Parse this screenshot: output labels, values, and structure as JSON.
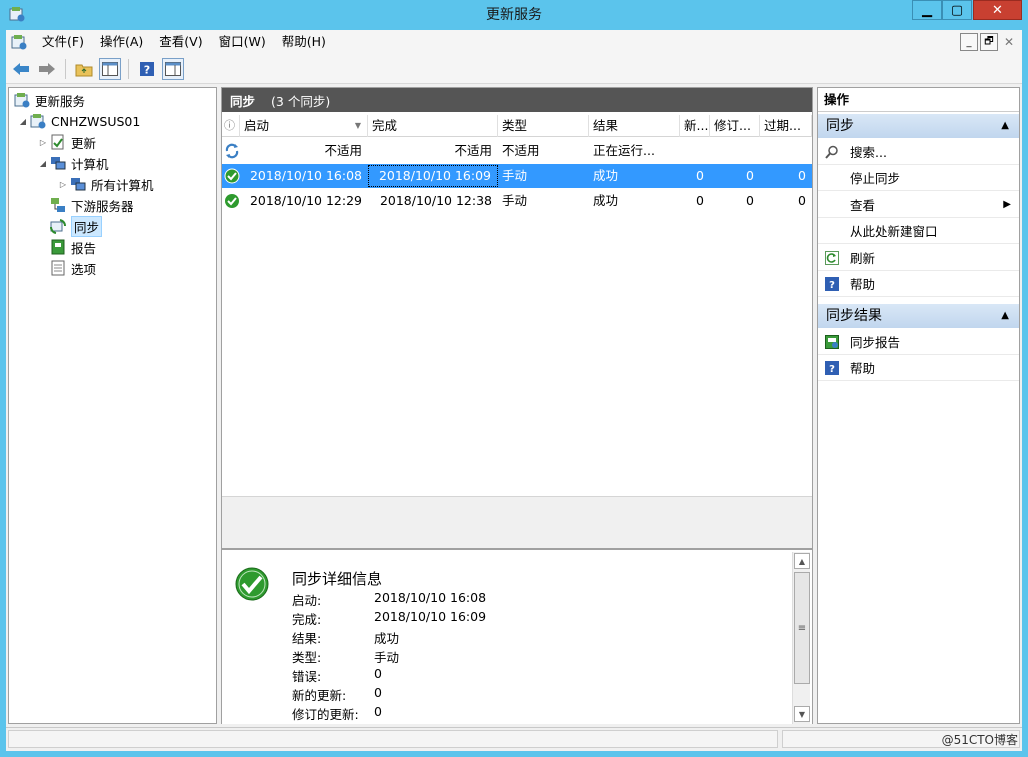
{
  "window": {
    "title": "更新服务",
    "min_glyph": "▁",
    "max_glyph": "▢",
    "close_glyph": "✕"
  },
  "menu": {
    "items": [
      "文件(F)",
      "操作(A)",
      "查看(V)",
      "窗口(W)",
      "帮助(H)"
    ]
  },
  "mdi": {
    "min": "_",
    "restore": "🗗",
    "close": "✕"
  },
  "tree": {
    "root": "更新服务",
    "server": "CNHZWSUS01",
    "updates": "更新",
    "computers": "计算机",
    "all_computers": "所有计算机",
    "downstream": "下游服务器",
    "sync": "同步",
    "reports": "报告",
    "options": "选项"
  },
  "middle": {
    "header_title": "同步",
    "header_sub": "(3 个同步)",
    "columns": [
      "启动",
      "完成",
      "类型",
      "结果",
      "新...",
      "修订...",
      "过期..."
    ],
    "rows": [
      {
        "start": "不适用",
        "finish": "不适用",
        "type": "不适用",
        "result": "正在运行...",
        "new": "",
        "revised": "",
        "expired": ""
      },
      {
        "start": "2018/10/10 16:08",
        "finish": "2018/10/10 16:09",
        "type": "手动",
        "result": "成功",
        "new": "0",
        "revised": "0",
        "expired": "0"
      },
      {
        "start": "2018/10/10 12:29",
        "finish": "2018/10/10 12:38",
        "type": "手动",
        "result": "成功",
        "new": "0",
        "revised": "0",
        "expired": "0"
      }
    ]
  },
  "detail": {
    "title": "同步详细信息",
    "fields": [
      {
        "label": "启动:",
        "value": "2018/10/10 16:08"
      },
      {
        "label": "完成:",
        "value": "2018/10/10 16:09"
      },
      {
        "label": "结果:",
        "value": "成功"
      },
      {
        "label": "类型:",
        "value": "手动"
      },
      {
        "label": "错误:",
        "value": "0"
      },
      {
        "label": "新的更新:",
        "value": "0"
      },
      {
        "label": "修订的更新:",
        "value": "0"
      }
    ]
  },
  "actions": {
    "header": "操作",
    "section1": "同步",
    "search": "搜索...",
    "stop_sync": "停止同步",
    "view": "查看",
    "new_window": "从此处新建窗口",
    "refresh": "刷新",
    "help1": "帮助",
    "section2": "同步结果",
    "sync_report": "同步报告",
    "help2": "帮助"
  },
  "watermark": "@51CTO博客",
  "colors": {
    "titlebar": "#5bc4ec",
    "selection": "#3399ff",
    "close": "#c84031"
  }
}
